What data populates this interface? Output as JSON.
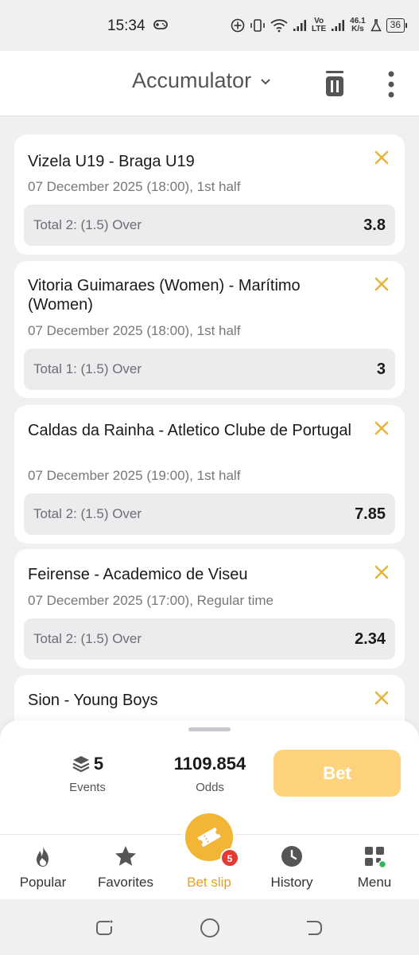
{
  "status_bar": {
    "time": "15:34",
    "network_speed": "46.1",
    "network_unit": "K/s",
    "volte_top": "Vo",
    "volte_bottom": "LTE",
    "battery": "36"
  },
  "header": {
    "title": "Accumulator"
  },
  "bets": [
    {
      "match": "Vizela U19 - Braga U19",
      "datetime": "07 December 2025 (18:00), 1st half",
      "market": "Total 2: (1.5) Over",
      "odds": "3.8"
    },
    {
      "match": "Vitoria Guimaraes (Women) - Marítimo (Women)",
      "datetime": "07 December 2025 (18:00), 1st half",
      "market": "Total 1: (1.5) Over",
      "odds": "3"
    },
    {
      "match": "Caldas da Rainha - Atletico Clube de Portugal",
      "datetime": "07 December 2025 (19:00), 1st half",
      "market": "Total 2: (1.5) Over",
      "odds": "7.85"
    },
    {
      "match": "Feirense - Academico de Viseu",
      "datetime": "07 December 2025 (17:00), Regular time",
      "market": "Total 2: (1.5) Over",
      "odds": "2.34"
    },
    {
      "match": "Sion - Young Boys"
    }
  ],
  "summary": {
    "events_count": "5",
    "events_label": "Events",
    "odds_total": "1109.854",
    "odds_label": "Odds",
    "bet_label": "Bet"
  },
  "nav": {
    "popular": "Popular",
    "favorites": "Favorites",
    "bet_slip": "Bet slip",
    "bet_slip_badge": "5",
    "history": "History",
    "menu": "Menu"
  },
  "colors": {
    "accent": "#f2b535",
    "bet_button": "#fdd47c",
    "close_icon": "#e8b43a",
    "badge": "#e53935"
  }
}
